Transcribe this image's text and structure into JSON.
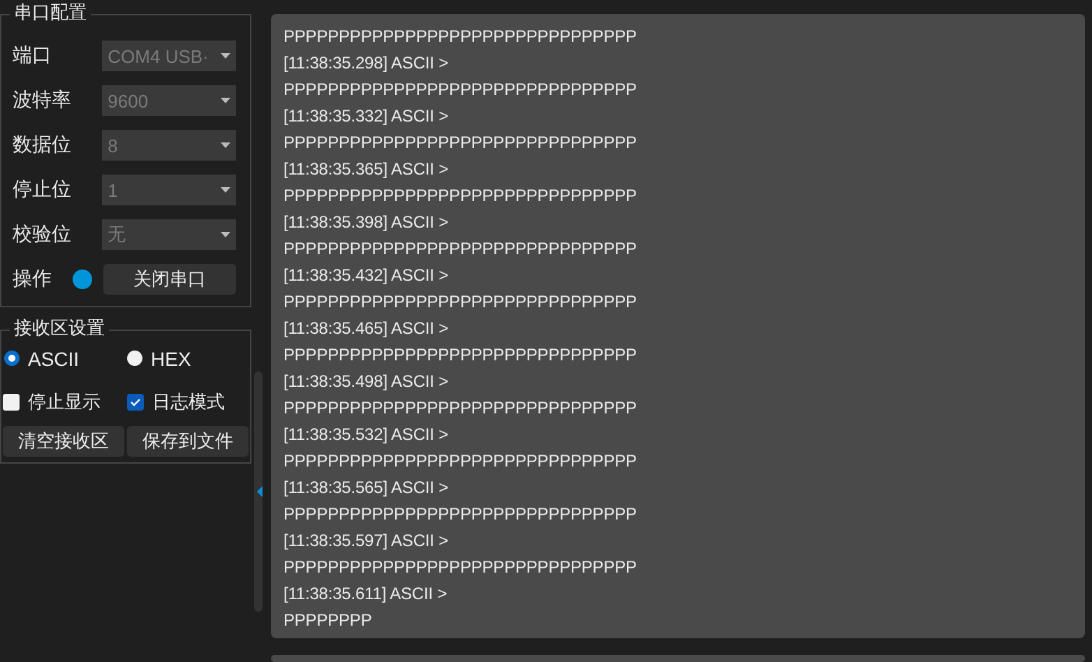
{
  "serial_config": {
    "title": "串口配置",
    "fields": [
      {
        "label": "端口",
        "value": "COM4 USB·",
        "disabled": true
      },
      {
        "label": "波特率",
        "value": "9600",
        "disabled": true
      },
      {
        "label": "数据位",
        "value": "8",
        "disabled": true
      },
      {
        "label": "停止位",
        "value": "1",
        "disabled": true
      },
      {
        "label": "校验位",
        "value": "无",
        "disabled": true
      }
    ],
    "operation": {
      "label": "操作",
      "on": true,
      "button": "关闭串口"
    }
  },
  "receive_settings": {
    "title": "接收区设置",
    "modes": [
      {
        "label": "ASCII",
        "selected": true
      },
      {
        "label": "HEX",
        "selected": false
      }
    ],
    "options": [
      {
        "label": "停止显示",
        "checked": false
      },
      {
        "label": "日志模式",
        "checked": true
      }
    ],
    "buttons": [
      "清空接收区",
      "保存到文件"
    ]
  },
  "log": {
    "lines": [
      "PPPPPPPPPPPPPPPPPPPPPPPPPPPPPPPP",
      "[11:38:35.298] ASCII >",
      "PPPPPPPPPPPPPPPPPPPPPPPPPPPPPPPP",
      "[11:38:35.332] ASCII >",
      "PPPPPPPPPPPPPPPPPPPPPPPPPPPPPPPP",
      "[11:38:35.365] ASCII >",
      "PPPPPPPPPPPPPPPPPPPPPPPPPPPPPPPP",
      "[11:38:35.398] ASCII >",
      "PPPPPPPPPPPPPPPPPPPPPPPPPPPPPPPP",
      "[11:38:35.432] ASCII >",
      "PPPPPPPPPPPPPPPPPPPPPPPPPPPPPPPP",
      "[11:38:35.465] ASCII >",
      "PPPPPPPPPPPPPPPPPPPPPPPPPPPPPPPP",
      "[11:38:35.498] ASCII >",
      "PPPPPPPPPPPPPPPPPPPPPPPPPPPPPPPP",
      "[11:38:35.532] ASCII >",
      "PPPPPPPPPPPPPPPPPPPPPPPPPPPPPPPP",
      "[11:38:35.565] ASCII >",
      "PPPPPPPPPPPPPPPPPPPPPPPPPPPPPPPP",
      "[11:38:35.597] ASCII >",
      "PPPPPPPPPPPPPPPPPPPPPPPPPPPPPPPP",
      "[11:38:35.611] ASCII >",
      "PPPPPPPP"
    ]
  }
}
